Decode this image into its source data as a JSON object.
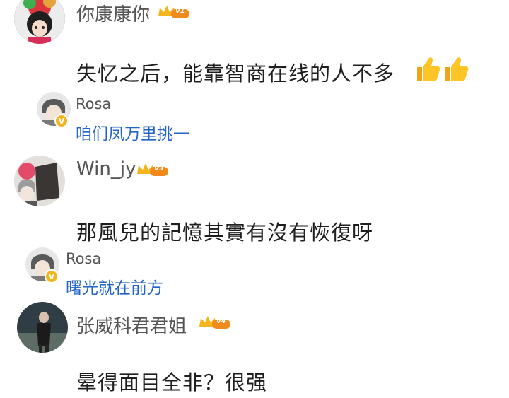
{
  "comments": [
    {
      "username": "你康康你",
      "level": "V1",
      "text": "失忆之后，能靠智商在线的人不多",
      "emoji": "thumbs-up-icon x2",
      "replies": [
        {
          "username": "Rosa",
          "text": "咱们凤万里挑一"
        }
      ]
    },
    {
      "username": "Win_jy",
      "level": "V3",
      "text": "那風兒的記憶其實有沒有恢復呀",
      "replies": [
        {
          "username": "Rosa",
          "text": "曙光就在前方"
        }
      ]
    },
    {
      "username": "张威科君君姐",
      "level": "V4",
      "text": "晕得面目全非？很强"
    }
  ],
  "colors": {
    "reply_link": "#2463c7",
    "badge_gold": "#f4b51c",
    "badge_orange": "#f08a1c"
  }
}
